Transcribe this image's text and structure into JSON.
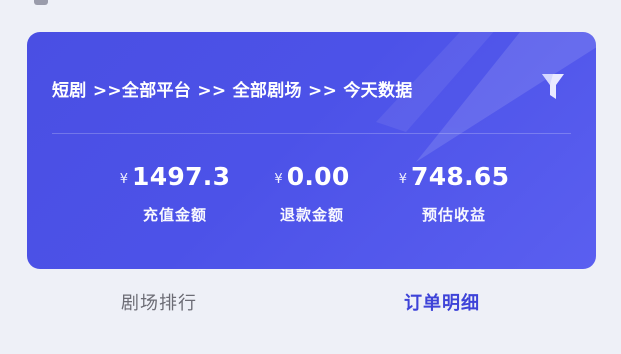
{
  "summary_card": {
    "breadcrumb": "短剧 >>全部平台 >> 全部剧场 >> 今天数据",
    "filter_icon": "filter-icon",
    "stats": [
      {
        "currency": "¥",
        "value": "1497.3",
        "label": "充值金额"
      },
      {
        "currency": "¥",
        "value": "0.00",
        "label": "退款金额"
      },
      {
        "currency": "¥",
        "value": "748.65",
        "label": "预估收益"
      }
    ]
  },
  "tabs": [
    {
      "label": "剧场排行",
      "active": false
    },
    {
      "label": "订单明细",
      "active": true
    }
  ],
  "colors": {
    "card_background": "#4c52e8",
    "page_background": "#eef0f7",
    "active_tab": "#3e43d8",
    "inactive_tab": "#6c6c75"
  }
}
